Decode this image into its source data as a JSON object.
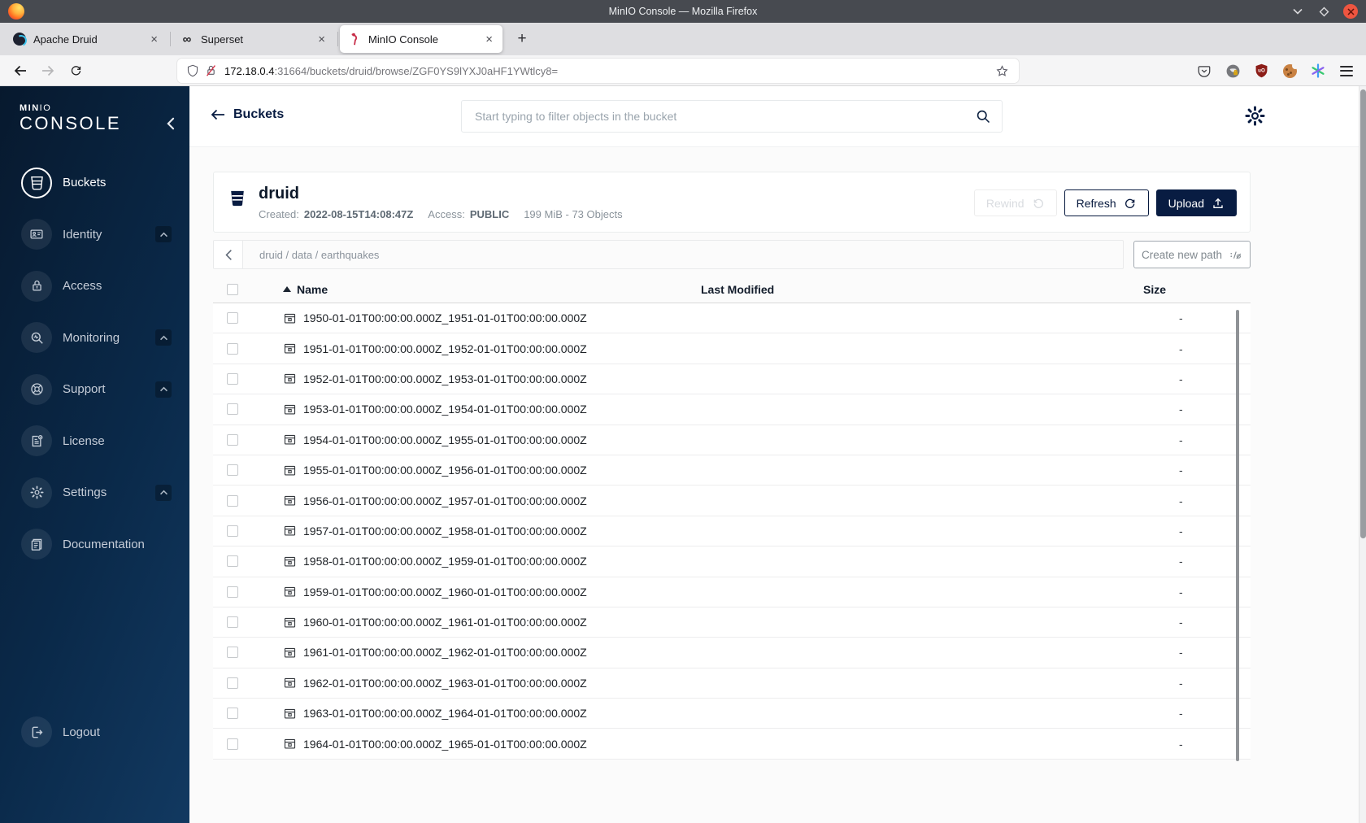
{
  "window": {
    "title": "MinIO Console — Mozilla Firefox"
  },
  "tabs": [
    {
      "label": "Apache Druid"
    },
    {
      "label": "Superset"
    },
    {
      "label": "MinIO Console"
    }
  ],
  "urlbar": {
    "host": "172.18.0.4",
    "rest": ":31664/buckets/druid/browse/ZGF0YS9lYXJ0aHF1YWtlcy8="
  },
  "sidebar": {
    "logo_bold": "MIN",
    "logo_light": "IO",
    "logo_secondary": "CONSOLE",
    "items": [
      {
        "label": "Buckets",
        "icon": "buckets",
        "active": true,
        "chevron": false
      },
      {
        "label": "Identity",
        "icon": "identity",
        "active": false,
        "chevron": true
      },
      {
        "label": "Access",
        "icon": "access",
        "active": false,
        "chevron": false
      },
      {
        "label": "Monitoring",
        "icon": "monitoring",
        "active": false,
        "chevron": true
      },
      {
        "label": "Support",
        "icon": "support",
        "active": false,
        "chevron": true
      },
      {
        "label": "License",
        "icon": "license",
        "active": false,
        "chevron": false
      },
      {
        "label": "Settings",
        "icon": "settings",
        "active": false,
        "chevron": true
      },
      {
        "label": "Documentation",
        "icon": "documentation",
        "active": false,
        "chevron": false
      }
    ],
    "logout_label": "Logout"
  },
  "header": {
    "back_label": "Buckets",
    "search_placeholder": "Start typing to filter objects in the bucket"
  },
  "bucket": {
    "name": "druid",
    "created_label": "Created:",
    "created_value": "2022-08-15T14:08:47Z",
    "access_label": "Access:",
    "access_value": "PUBLIC",
    "usage": "199 MiB - 73 Objects",
    "rewind_label": "Rewind",
    "refresh_label": "Refresh",
    "upload_label": "Upload"
  },
  "path_bar": {
    "breadcrumb": "druid / data / earthquakes",
    "create_path_label": "Create new path"
  },
  "table": {
    "columns": {
      "name": "Name",
      "modified": "Last Modified",
      "size": "Size"
    },
    "rows": [
      {
        "name": "1950-01-01T00:00:00.000Z_1951-01-01T00:00:00.000Z",
        "size": "-"
      },
      {
        "name": "1951-01-01T00:00:00.000Z_1952-01-01T00:00:00.000Z",
        "size": "-"
      },
      {
        "name": "1952-01-01T00:00:00.000Z_1953-01-01T00:00:00.000Z",
        "size": "-"
      },
      {
        "name": "1953-01-01T00:00:00.000Z_1954-01-01T00:00:00.000Z",
        "size": "-"
      },
      {
        "name": "1954-01-01T00:00:00.000Z_1955-01-01T00:00:00.000Z",
        "size": "-"
      },
      {
        "name": "1955-01-01T00:00:00.000Z_1956-01-01T00:00:00.000Z",
        "size": "-"
      },
      {
        "name": "1956-01-01T00:00:00.000Z_1957-01-01T00:00:00.000Z",
        "size": "-"
      },
      {
        "name": "1957-01-01T00:00:00.000Z_1958-01-01T00:00:00.000Z",
        "size": "-"
      },
      {
        "name": "1958-01-01T00:00:00.000Z_1959-01-01T00:00:00.000Z",
        "size": "-"
      },
      {
        "name": "1959-01-01T00:00:00.000Z_1960-01-01T00:00:00.000Z",
        "size": "-"
      },
      {
        "name": "1960-01-01T00:00:00.000Z_1961-01-01T00:00:00.000Z",
        "size": "-"
      },
      {
        "name": "1961-01-01T00:00:00.000Z_1962-01-01T00:00:00.000Z",
        "size": "-"
      },
      {
        "name": "1962-01-01T00:00:00.000Z_1963-01-01T00:00:00.000Z",
        "size": "-"
      },
      {
        "name": "1963-01-01T00:00:00.000Z_1964-01-01T00:00:00.000Z",
        "size": "-"
      },
      {
        "name": "1964-01-01T00:00:00.000Z_1965-01-01T00:00:00.000Z",
        "size": "-"
      }
    ]
  },
  "colors": {
    "accent_navy": "#081C42",
    "sidebar_gradient_from": "#07192e",
    "sidebar_gradient_to": "#15406b",
    "close_button_red": "#ee5540"
  }
}
